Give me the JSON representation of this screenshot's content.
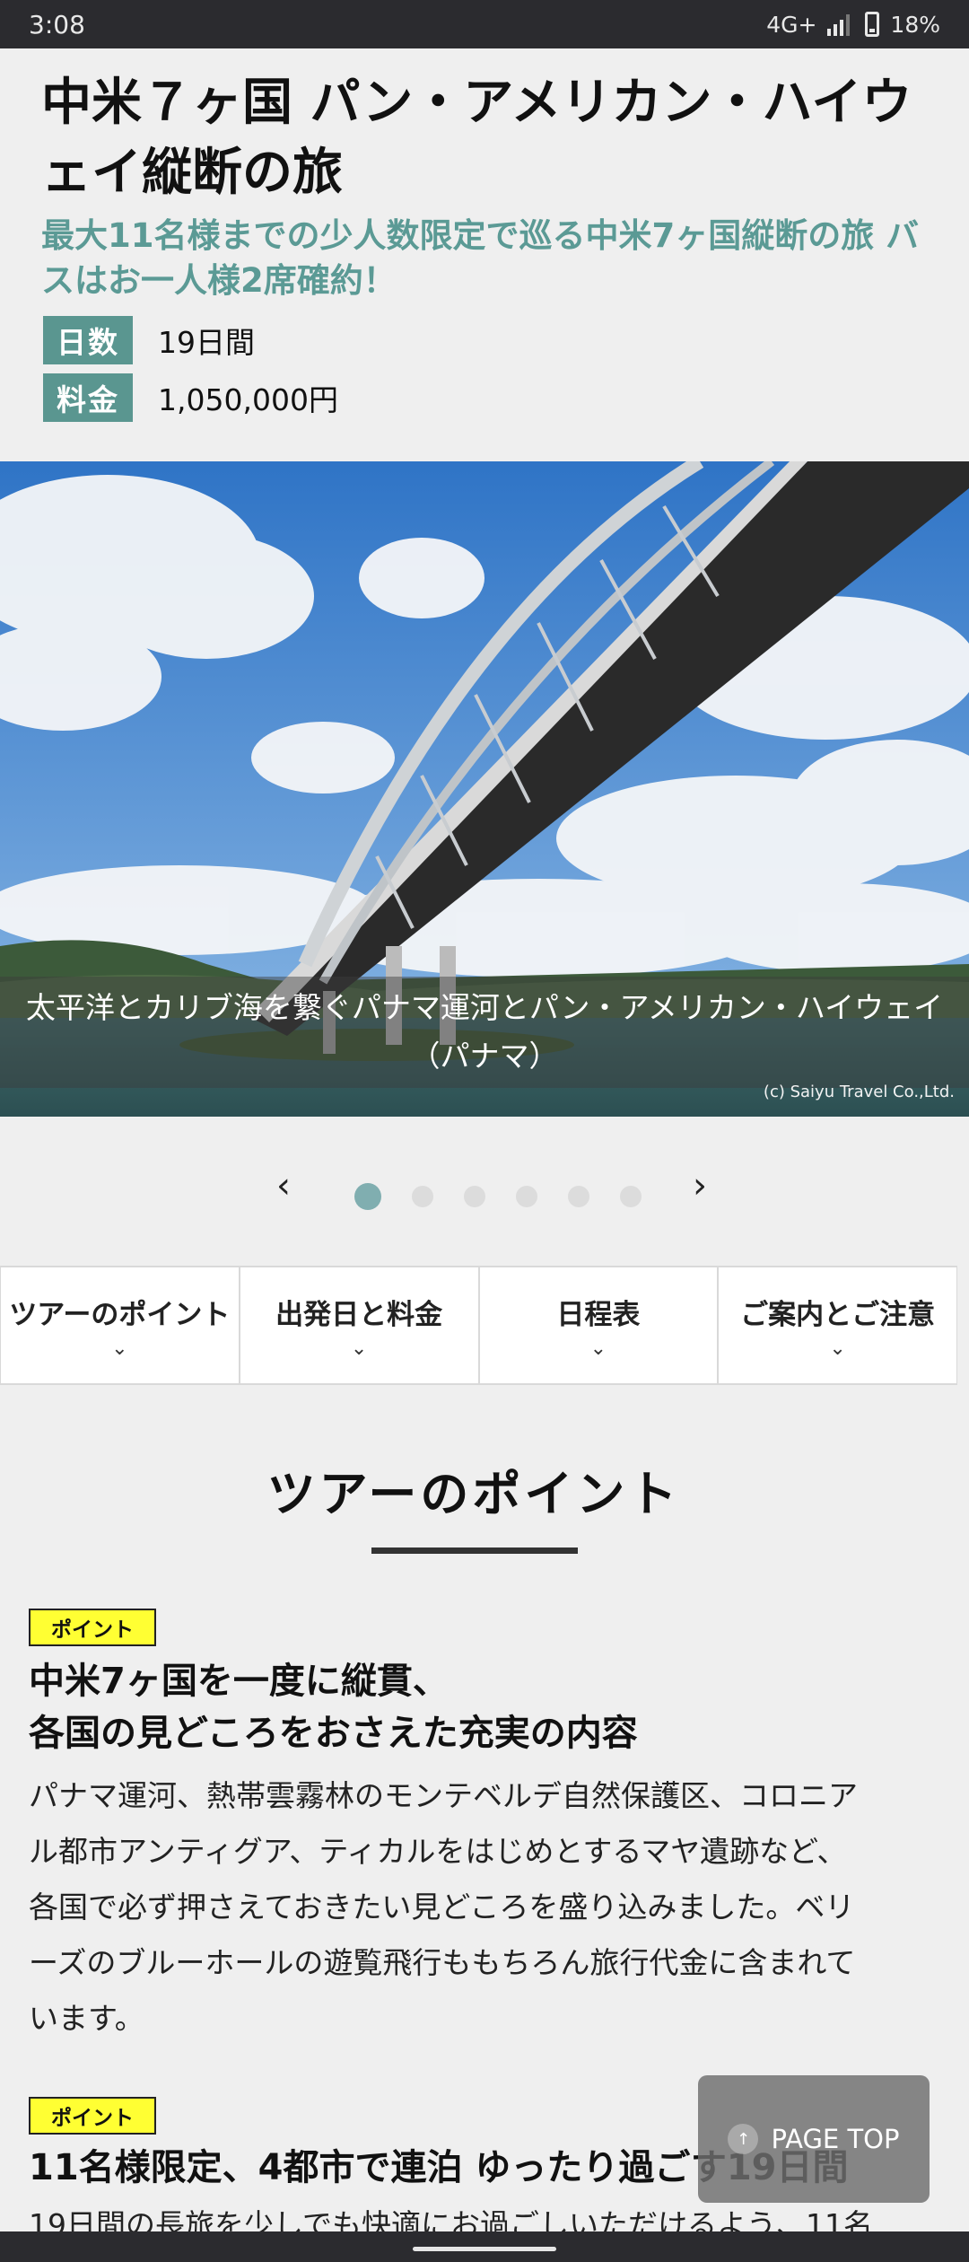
{
  "status_bar": {
    "time": "3:08",
    "network": "4G+",
    "battery": "18%"
  },
  "tour": {
    "title": "中米７ヶ国 パン・アメリカン・ハイウェイ縦断の旅",
    "subtitle": "最大11名様までの少人数限定で巡る中米7ヶ国縦断の旅 バスはお一人様2席確約！",
    "days_label": "日数",
    "days_value": "19日間",
    "price_label": "料金",
    "price_value": "1,050,000円"
  },
  "hero": {
    "caption_line1": "太平洋とカリブ海を繋ぐパナマ運河とパン・アメリカン・ハイウェイ",
    "caption_line2": "（パナマ）",
    "credit": "(c) Saiyu Travel Co.,Ltd.",
    "active_slide": 1,
    "slide_count": 6
  },
  "carousel": {
    "prev": "‹",
    "next": "›"
  },
  "tabs": [
    {
      "label": "ツアーのポイント"
    },
    {
      "label": "出発日と料金"
    },
    {
      "label": "日程表"
    },
    {
      "label": "ご案内とご注意"
    }
  ],
  "section": {
    "title": "ツアーのポイント"
  },
  "points": [
    {
      "badge": "ポイント",
      "heading_line1": "中米7ヶ国を一度に縦貫、",
      "heading_line2": "各国の見どころをおさえた充実の内容",
      "text_lines": [
        "パナマ運河、熱帯雲霧林のモンテベルデ自然保護区、コロニア",
        "ル都市アンティグア、ティカルをはじめとするマヤ遺跡など、",
        "各国で必ず押さえておきたい見どころを盛り込みました。ベリ",
        "ーズのブルーホールの遊覧飛行ももちろん旅行代金に含まれて",
        "います。"
      ]
    },
    {
      "badge": "ポイント",
      "heading_line1": "11名様限定、4都市で連泊 ゆったり過ごす19日間",
      "text_lines": [
        "19日間の長旅を少しでも快適にお過ごしいただけるよう、11名"
      ]
    }
  ],
  "page_top": {
    "label": "PAGE TOP"
  }
}
